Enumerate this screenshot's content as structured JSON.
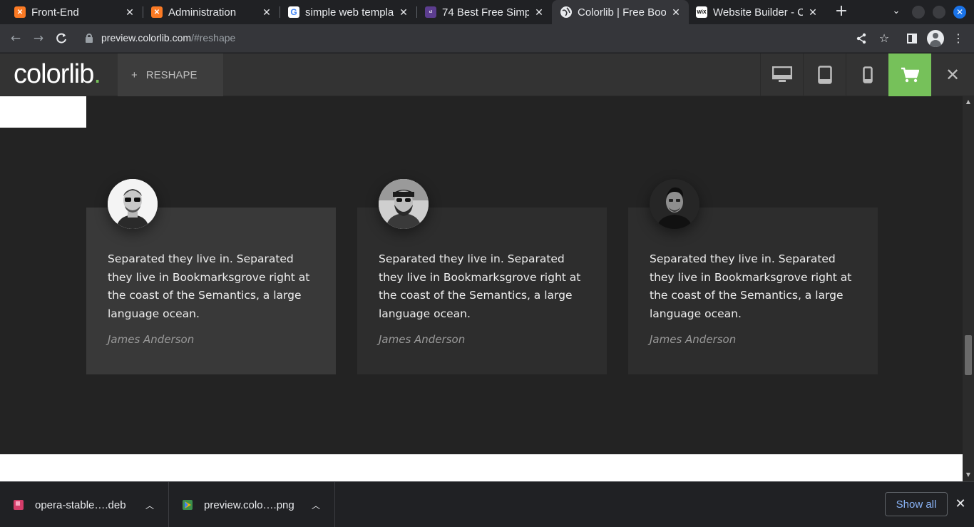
{
  "browser": {
    "tabs": [
      {
        "title": "Front-End",
        "favicon": "xampp-icon",
        "color": "#fb7a24",
        "active": false
      },
      {
        "title": "Administration",
        "favicon": "xampp-icon",
        "color": "#fb7a24",
        "active": false
      },
      {
        "title": "simple web templa",
        "favicon": "google-icon",
        "color": "#ffffff",
        "active": false
      },
      {
        "title": "74 Best Free Simple",
        "favicon": "colorlib-icon",
        "color": "#5c3d8f",
        "active": false
      },
      {
        "title": "Colorlib | Free Boo",
        "favicon": "globe-icon",
        "color": "#e8eaed",
        "active": true
      },
      {
        "title": "Website Builder - C",
        "favicon": "wix-icon",
        "color": "#ffffff",
        "active": false
      }
    ],
    "tab_close_glyph": "✕",
    "new_tab_glyph": "+",
    "address": {
      "domain": "preview.colorlib.com",
      "path": "/#reshape"
    }
  },
  "colorlib_bar": {
    "logo_text": "colorlib",
    "logo_dot": ".",
    "theme_plus": "+",
    "theme_name": "RESHAPE",
    "devices": [
      "desktop-icon",
      "tablet-icon",
      "mobile-icon"
    ],
    "accent_color": "#76c15a"
  },
  "testimonials": [
    {
      "quote": "Separated they live in. Separated they live in Bookmarksgrove right at the coast of the Semantics, a large language ocean.",
      "author": "James Anderson"
    },
    {
      "quote": "Separated they live in. Separated they live in Bookmarksgrove right at the coast of the Semantics, a large language ocean.",
      "author": "James Anderson"
    },
    {
      "quote": "Separated they live in. Separated they live in Bookmarksgrove right at the coast of the Semantics, a large language ocean.",
      "author": "James Anderson"
    }
  ],
  "downloads": [
    {
      "name": "opera-stable….deb",
      "icon": "deb-package-icon"
    },
    {
      "name": "preview.colo….png",
      "icon": "image-file-icon"
    }
  ],
  "shelf": {
    "show_all": "Show all"
  }
}
